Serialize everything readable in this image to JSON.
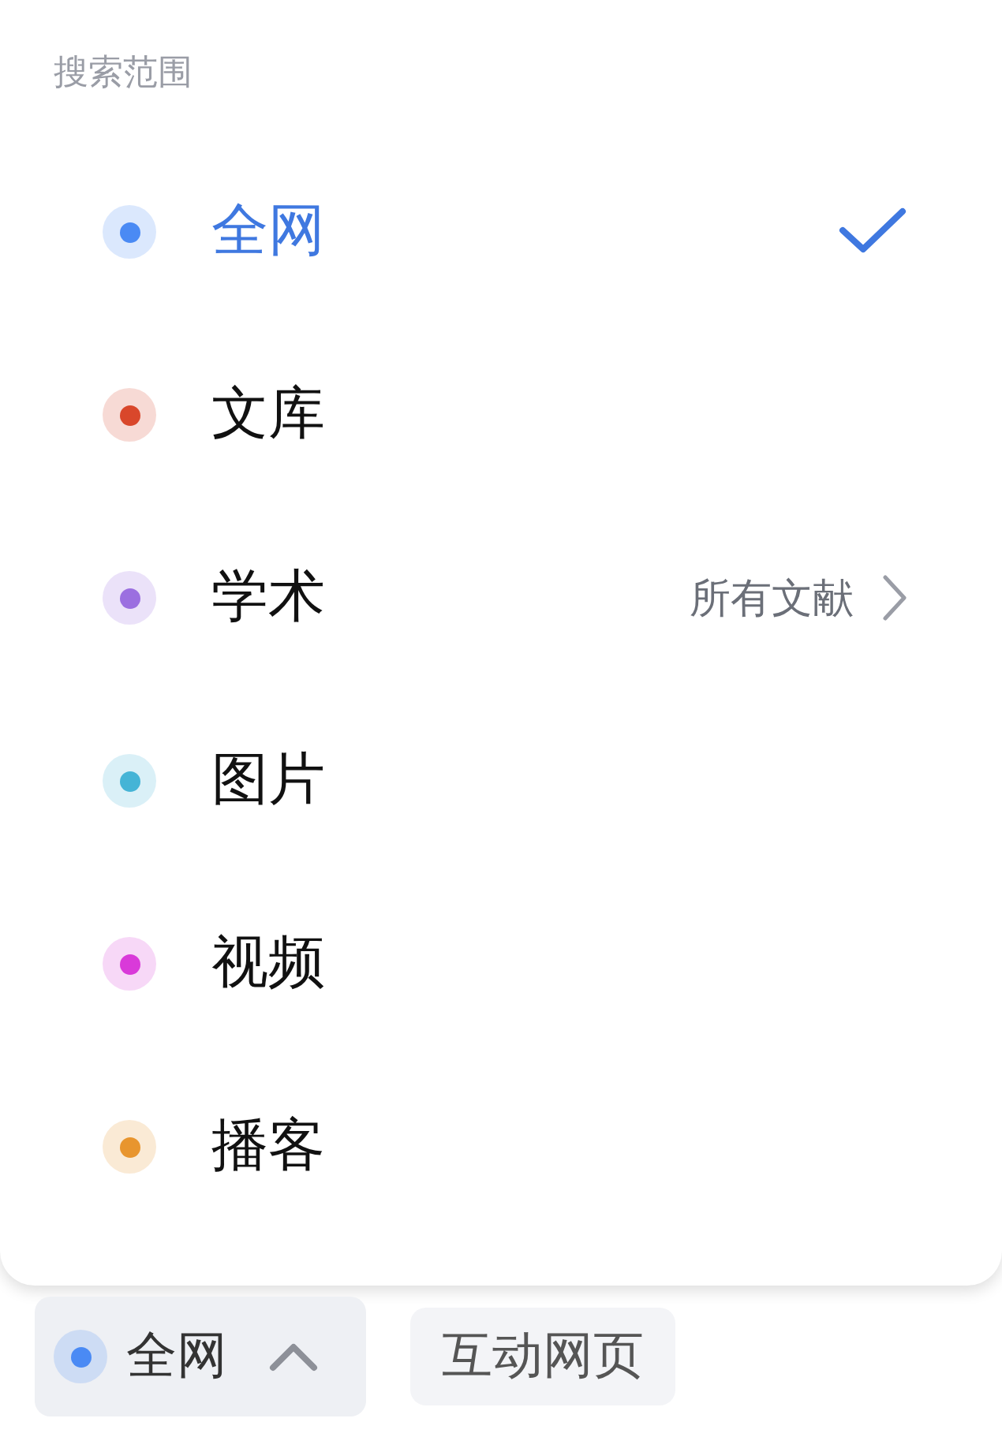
{
  "menu": {
    "title": "搜索范围",
    "items": [
      {
        "label": "全网",
        "color": "#4a8af4",
        "selected": true
      },
      {
        "label": "文库",
        "color": "#d9472b",
        "selected": false
      },
      {
        "label": "学术",
        "color": "#9b6fe0",
        "selected": false,
        "detail": "所有文献"
      },
      {
        "label": "图片",
        "color": "#45b4d6",
        "selected": false
      },
      {
        "label": "视频",
        "color": "#d93ad9",
        "selected": false
      },
      {
        "label": "播客",
        "color": "#e8952e",
        "selected": false
      }
    ]
  },
  "toolbar": {
    "scope": {
      "label": "全网",
      "color": "#4a8af4",
      "expanded": true
    },
    "chips": [
      "互动网页"
    ]
  }
}
